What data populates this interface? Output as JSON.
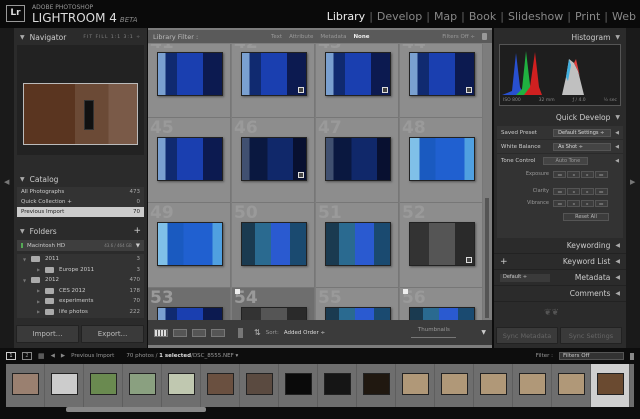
{
  "app": {
    "logo": "Lr",
    "brand_small": "ADOBE PHOTOSHOP",
    "brand_name": "LIGHTROOM 4",
    "brand_tag": "BETA"
  },
  "modules": [
    {
      "label": "Library",
      "active": true
    },
    {
      "label": "Develop"
    },
    {
      "label": "Map"
    },
    {
      "label": "Book"
    },
    {
      "label": "Slideshow"
    },
    {
      "label": "Print"
    },
    {
      "label": "Web"
    }
  ],
  "navigator": {
    "title": "Navigator",
    "options": "FIT  FILL  1:1  3:1 ÷"
  },
  "catalog": {
    "title": "Catalog",
    "items": [
      {
        "label": "All Photographs",
        "count": "473"
      },
      {
        "label": "Quick Collection +",
        "count": "0"
      },
      {
        "label": "Previous Import",
        "count": "70",
        "selected": true
      }
    ]
  },
  "folders": {
    "title": "Folders",
    "plus": "+",
    "volume": {
      "label": "Macintosh HD",
      "size": "43.6 / 464 GB"
    },
    "items": [
      {
        "label": "2011",
        "count": "3",
        "level": 0
      },
      {
        "label": "Europe 2011",
        "count": "3",
        "level": 1
      },
      {
        "label": "2012",
        "count": "470",
        "level": 0
      },
      {
        "label": "CES 2012",
        "count": "178",
        "level": 1
      },
      {
        "label": "experiments",
        "count": "70",
        "level": 1
      },
      {
        "label": "life photos",
        "count": "222",
        "level": 1
      }
    ]
  },
  "left_buttons": {
    "import": "Import...",
    "export": "Export..."
  },
  "filter_bar": {
    "label": "Library Filter :",
    "tabs": [
      "Text",
      "Attribute",
      "Metadata",
      "None"
    ],
    "active": "None",
    "state": "Filters Off ÷"
  },
  "grid": {
    "cells": [
      {
        "num": "41",
        "tone": "blue"
      },
      {
        "num": "42",
        "tone": "blue",
        "badge": true
      },
      {
        "num": "43",
        "tone": "blue",
        "badge": true
      },
      {
        "num": "44",
        "tone": "blue",
        "badge": true
      },
      {
        "num": "45",
        "tone": "blue"
      },
      {
        "num": "46",
        "tone": "darkblue",
        "badge": true
      },
      {
        "num": "47",
        "tone": "darkblue"
      },
      {
        "num": "48",
        "tone": "lightblue"
      },
      {
        "num": "49",
        "tone": "lightblue"
      },
      {
        "num": "50",
        "tone": "teal"
      },
      {
        "num": "51",
        "tone": "teal"
      },
      {
        "num": "52",
        "tone": "gray",
        "badge": true
      },
      {
        "num": "53",
        "tone": "blue",
        "dark": true
      },
      {
        "num": "54",
        "tone": "gray",
        "dark": true,
        "flag": true
      },
      {
        "num": "55",
        "tone": "teal"
      },
      {
        "num": "56",
        "tone": "teal",
        "flag": true
      }
    ]
  },
  "toolbar": {
    "sort_label": "Sort:",
    "sort_value": "Added Order ÷",
    "thumbnails_label": "Thumbnails"
  },
  "histogram": {
    "title": "Histogram",
    "iso": "ISO 800",
    "focal": "32 mm",
    "aperture": "ƒ / 4.0",
    "shutter": "½ sec"
  },
  "quick_develop": {
    "title": "Quick Develop",
    "saved_preset_label": "Saved Preset",
    "saved_preset_value": "Default Settings ÷",
    "white_balance_label": "White Balance",
    "white_balance_value": "As Shot ÷",
    "tone_control_label": "Tone Control",
    "auto_tone": "Auto Tone",
    "sliders": [
      "Exposure",
      "Clarity",
      "Vibrance"
    ],
    "step_buttons": [
      "◂◂",
      "◂",
      "▸",
      "▸▸"
    ],
    "reset_all": "Reset All"
  },
  "right_sections": {
    "keywording": "Keywording",
    "keyword_list": "Keyword List",
    "metadata": "Metadata",
    "metadata_preset": "Default ÷",
    "comments": "Comments"
  },
  "right_buttons": {
    "sync_metadata": "Sync Metadata",
    "sync_settings": "Sync Settings"
  },
  "bottom_bar": {
    "screen1": "1",
    "screen2": "2",
    "source": "Previous Import",
    "count": "70 photos /",
    "selected": "1 selected",
    "file": "/DSC_8555.NEF ▾",
    "filter_label": "Filter :",
    "filter_value": "Filters Off"
  },
  "filmstrip": [
    "#9a8070",
    "#ccc",
    "#6a8a50",
    "#8aa080",
    "#c0c8b0",
    "#6a5040",
    "#5a4a40",
    "#0a0a0a",
    "#151515",
    "#201810",
    "#b09878",
    "#b09878",
    "#b09878",
    "#b09878",
    "#b09878",
    "#6a4a30"
  ]
}
